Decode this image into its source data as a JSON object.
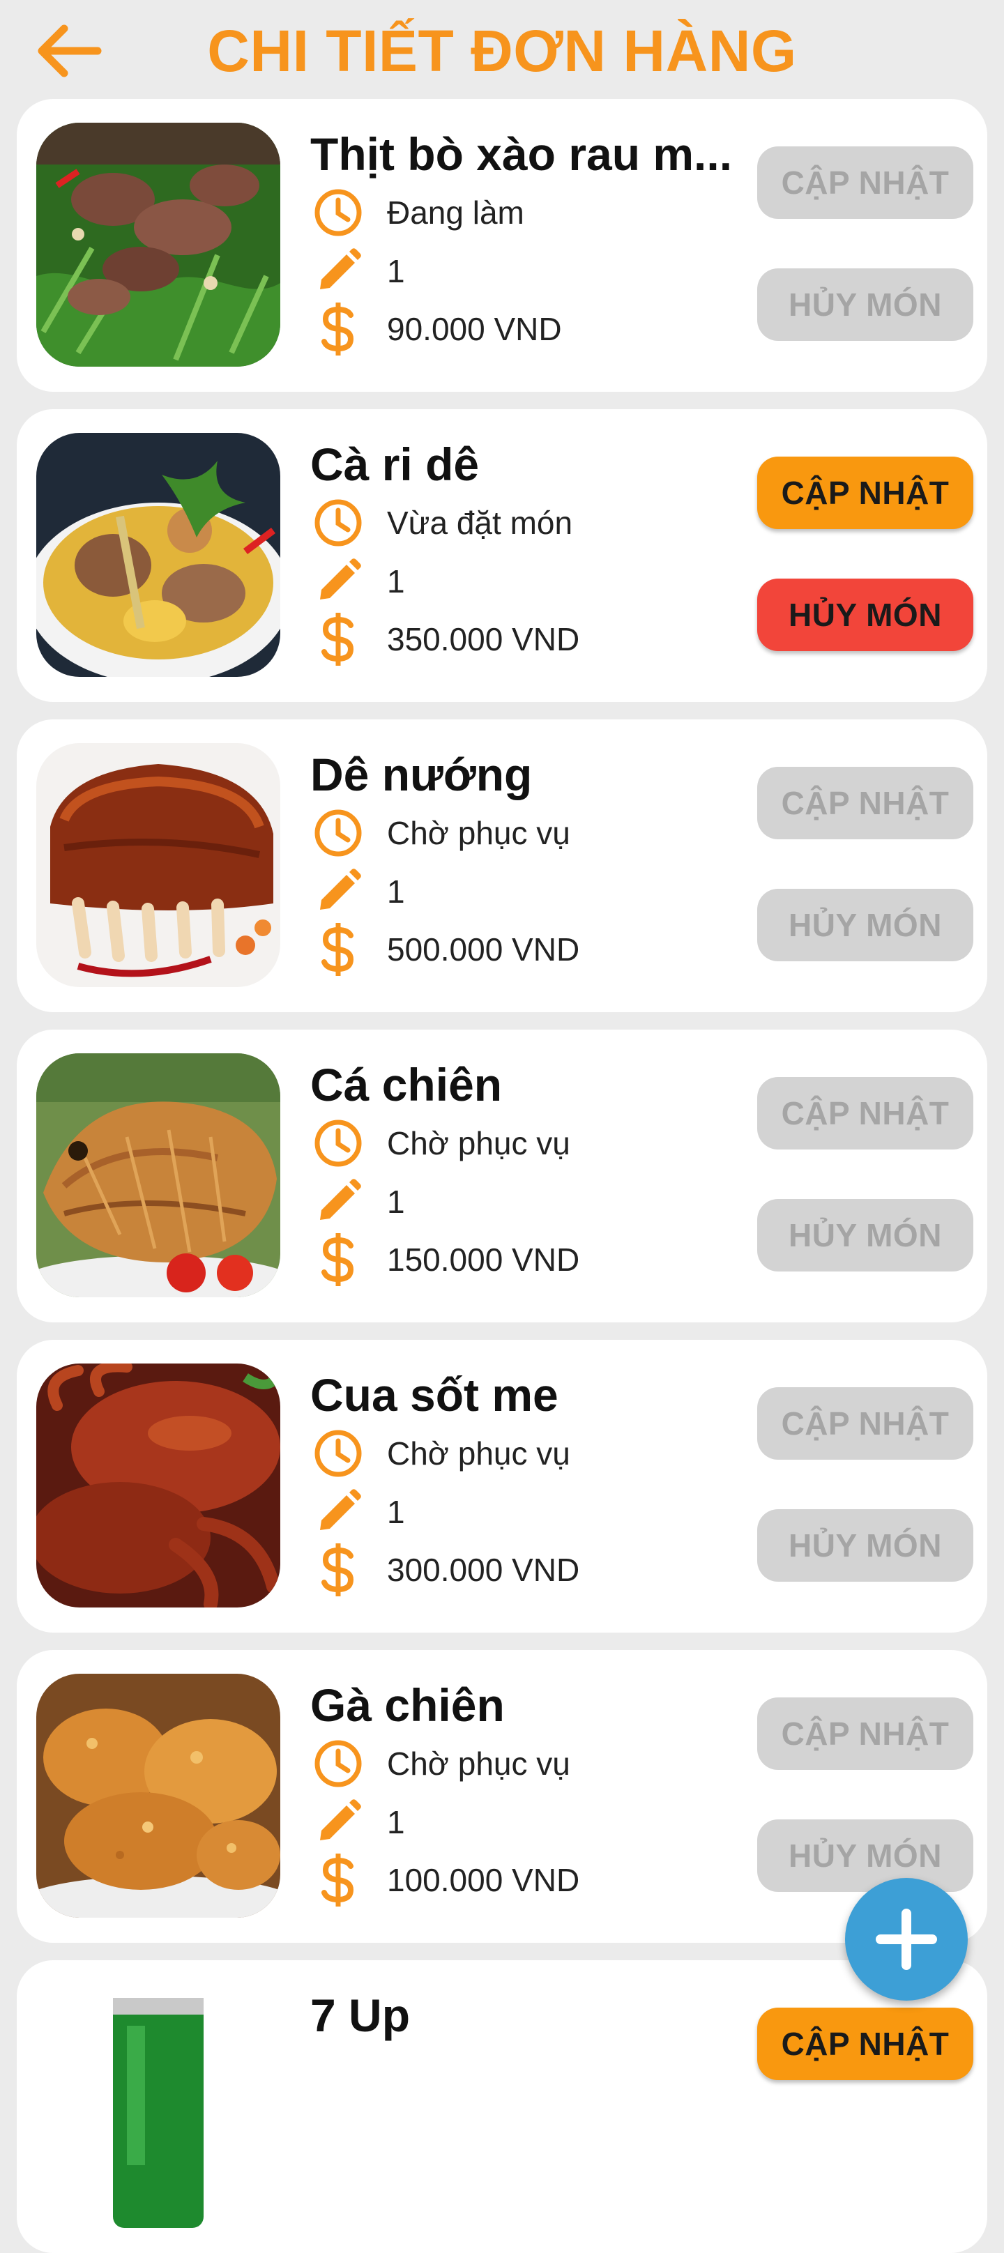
{
  "header": {
    "title": "CHI TIẾT ĐƠN HÀNG"
  },
  "colors": {
    "accent": "#f7941d",
    "update_active": "#f9980f",
    "cancel_active": "#f2453a",
    "disabled_bg": "#d3d3d3",
    "fab": "#3d9fd6"
  },
  "icons": {
    "back": "arrow-left-icon",
    "status": "clock-icon",
    "quantity": "pencil-icon",
    "price": "dollar-icon",
    "fab": "plus-icon"
  },
  "buttons": {
    "update": "CẬP NHẬT",
    "cancel": "HỦY MÓN"
  },
  "items": [
    {
      "name": "Thịt bò xào rau m...",
      "status": "Đang làm",
      "quantity": "1",
      "price": "90.000 VND",
      "actions_enabled": false
    },
    {
      "name": "Cà ri dê",
      "status": "Vừa đặt món",
      "quantity": "1",
      "price": "350.000 VND",
      "actions_enabled": true
    },
    {
      "name": "Dê nướng",
      "status": "Chờ phục vụ",
      "quantity": "1",
      "price": "500.000 VND",
      "actions_enabled": false
    },
    {
      "name": "Cá chiên",
      "status": "Chờ phục vụ",
      "quantity": "1",
      "price": "150.000 VND",
      "actions_enabled": false
    },
    {
      "name": "Cua sốt me",
      "status": "Chờ phục vụ",
      "quantity": "1",
      "price": "300.000 VND",
      "actions_enabled": false
    },
    {
      "name": "Gà chiên",
      "status": "Chờ phục vụ",
      "quantity": "1",
      "price": "100.000 VND",
      "actions_enabled": false
    },
    {
      "name": "7 Up",
      "actions_enabled": true
    }
  ]
}
